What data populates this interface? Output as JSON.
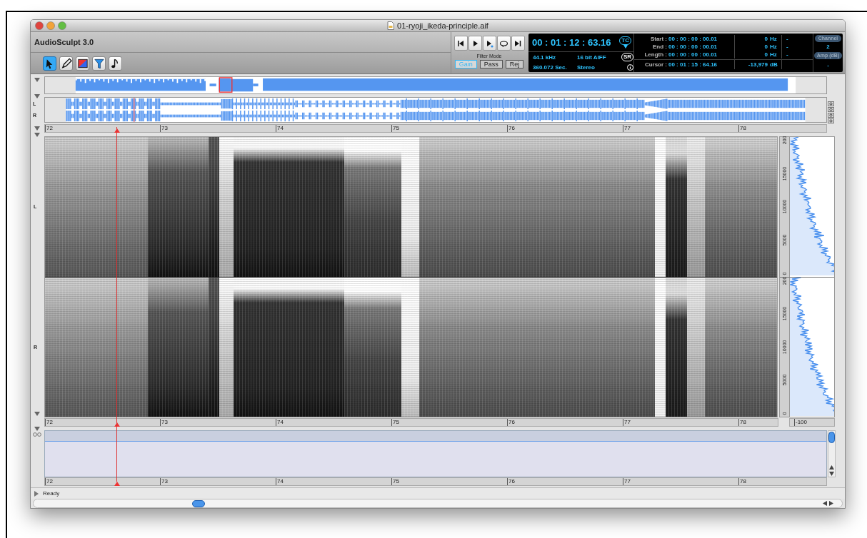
{
  "window": {
    "title": "01-ryoji_ikeda-principle.aif"
  },
  "app_name": "AudioSculpt 3.0",
  "tools": [
    {
      "kind": "pointer",
      "selected": true
    },
    {
      "kind": "pencil",
      "selected": false
    },
    {
      "kind": "palette",
      "selected": false
    },
    {
      "kind": "filter",
      "selected": false
    },
    {
      "kind": "note",
      "selected": false
    }
  ],
  "filter_mode": {
    "label": "Filter Mode",
    "options": [
      {
        "label": "Gain",
        "selected": true
      },
      {
        "label": "Pass",
        "selected": false
      },
      {
        "label": "Rej",
        "selected": false
      }
    ]
  },
  "display": {
    "time": "00 : 01 : 12 : 63.16",
    "time_badge": "TC",
    "sample_rate": "44.1 kHz",
    "format": "16 bit AIFF",
    "duration": "360.072 Sec.",
    "channels": "Stereo",
    "rate_badge": "SR",
    "selection": [
      {
        "label": "Start :",
        "time": "00 : 00 : 00 : 00.01",
        "frequency": "0",
        "unit": "Hz",
        "extra": "-"
      },
      {
        "label": "End :",
        "time": "00 : 00 : 00 : 00.01",
        "frequency": "0",
        "unit": "Hz",
        "extra": "-"
      },
      {
        "label": "Length :",
        "time": "00 : 00 : 00 : 00.01",
        "frequency": "0",
        "unit": "Hz",
        "extra": "-"
      }
    ],
    "cursor": {
      "label": "Cursor :",
      "time": "00 : 01 : 15 : 64.16",
      "value": "-13,979",
      "unit": "dB"
    },
    "channel": {
      "label": "Channel",
      "value": "2"
    },
    "amplitude": {
      "label": "Amp (dB)",
      "value": "-"
    }
  },
  "waveform": {
    "channels": [
      "L",
      "R"
    ]
  },
  "rulers": [
    {
      "labels": [
        "72",
        "73",
        "74",
        "75",
        "76",
        "77",
        "78"
      ]
    },
    {
      "labels": [
        "72",
        "73",
        "74",
        "75",
        "76",
        "77",
        "78"
      ]
    },
    {
      "labels": [
        "72",
        "73",
        "74",
        "75",
        "76",
        "77",
        "78"
      ]
    }
  ],
  "spectrogram": {
    "channels": [
      {
        "label": "L",
        "frequency_labels": [
          "200",
          "15000",
          "10000",
          "5000",
          "0"
        ]
      },
      {
        "label": "R",
        "frequency_labels": [
          "200",
          "15000",
          "10000",
          "5000",
          "0"
        ]
      }
    ],
    "amplitude_label": "-100"
  },
  "status_bar": {
    "text": "Ready"
  }
}
